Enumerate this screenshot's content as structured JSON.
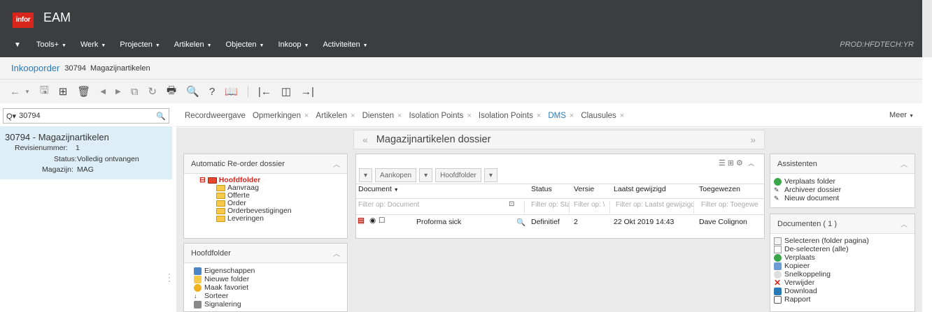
{
  "header": {
    "logo": "infor",
    "app_title": "EAM",
    "environment": "PROD:HFDTECH:YR"
  },
  "nav": [
    {
      "label": "Tools+"
    },
    {
      "label": "Werk"
    },
    {
      "label": "Projecten"
    },
    {
      "label": "Artikelen"
    },
    {
      "label": "Objecten"
    },
    {
      "label": "Inkoop"
    },
    {
      "label": "Activiteiten"
    }
  ],
  "title": {
    "entity": "Inkooporder",
    "code": "30794",
    "description": "Magazijnartikelen"
  },
  "search": {
    "value": "30794"
  },
  "record": {
    "title": "30794 - Magazijnartikelen",
    "rev_label": "Revisienummer:",
    "rev_value": "1",
    "status_label": "Status:",
    "status_value": "Volledig ontvangen",
    "mag_label": "Magazijn:",
    "mag_value": "MAG"
  },
  "tabs": [
    {
      "label": "Recordweergave"
    },
    {
      "label": "Opmerkingen"
    },
    {
      "label": "Artikelen"
    },
    {
      "label": "Diensten"
    },
    {
      "label": "Isolation Points"
    },
    {
      "label": "Isolation Points"
    },
    {
      "label": "DMS"
    },
    {
      "label": "Clausules"
    }
  ],
  "meer": "Meer",
  "dossier": {
    "title": "Magazijnartikelen dossier"
  },
  "reorder": {
    "title": "Automatic Re-order dossier",
    "root": "Hoofdfolder",
    "children": [
      "Aanvraag",
      "Offerte",
      "Order",
      "Orderbevestigingen",
      "Leveringen"
    ]
  },
  "hoofdfolder": {
    "title": "Hoofdfolder",
    "items": [
      "Eigenschappen",
      "Nieuwe folder",
      "Maak favoriet",
      "Sorteer",
      "Signalering"
    ]
  },
  "docs": {
    "btn1": "Aankopen",
    "btn2": "Hoofdfolder",
    "columns": [
      "Document",
      "Status",
      "Versie",
      "Laatst gewijzigd",
      "Toegewezen"
    ],
    "filters": [
      "Filter op: Document",
      "Filter op: Sta",
      "Filter op: \\",
      "Filter op: Laatst gewijzigd",
      "Filter op: Toegewe"
    ],
    "row": {
      "document": "Proforma sick",
      "status": "Definitief",
      "versie": "2",
      "gewijzigd": "22 Okt 2019 14:43",
      "toegewezen": "Dave Colignon"
    }
  },
  "assistenten": {
    "title": "Assistenten",
    "items": [
      "Verplaats folder",
      "Archiveer dossier",
      "Nieuw document"
    ]
  },
  "documenten": {
    "title": "Documenten ( 1 )",
    "items": [
      "Selecteren (folder pagina)",
      "De-selecteren (alle)",
      "Verplaats",
      "Kopieer",
      "Snelkoppeling",
      "Verwijder",
      "Download",
      "Rapport"
    ]
  }
}
